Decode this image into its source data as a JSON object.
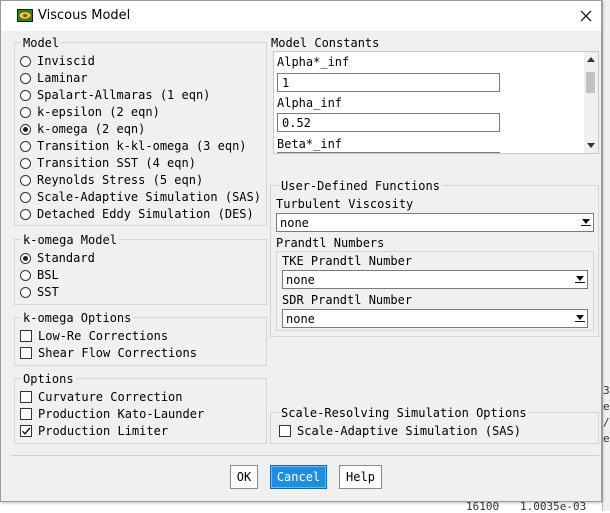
{
  "window": {
    "title": "Viscous Model"
  },
  "model": {
    "title": "Model",
    "options": [
      {
        "label": "Inviscid",
        "selected": false
      },
      {
        "label": "Laminar",
        "selected": false
      },
      {
        "label": "Spalart-Allmaras (1 eqn)",
        "selected": false
      },
      {
        "label": "k-epsilon (2 eqn)",
        "selected": false
      },
      {
        "label": "k-omega (2 eqn)",
        "selected": true
      },
      {
        "label": "Transition k-kl-omega (3 eqn)",
        "selected": false
      },
      {
        "label": "Transition SST (4 eqn)",
        "selected": false
      },
      {
        "label": "Reynolds Stress (5 eqn)",
        "selected": false
      },
      {
        "label": "Scale-Adaptive Simulation (SAS)",
        "selected": false
      },
      {
        "label": "Detached Eddy Simulation (DES)",
        "selected": false
      }
    ]
  },
  "komega_model": {
    "title": "k-omega Model",
    "options": [
      {
        "label": "Standard",
        "selected": true
      },
      {
        "label": "BSL",
        "selected": false
      },
      {
        "label": "SST",
        "selected": false
      }
    ]
  },
  "komega_options": {
    "title": "k-omega Options",
    "items": [
      {
        "label": "Low-Re Corrections",
        "checked": false
      },
      {
        "label": "Shear Flow Corrections",
        "checked": false
      }
    ]
  },
  "options": {
    "title": "Options",
    "items": [
      {
        "label": "Curvature Correction",
        "checked": false
      },
      {
        "label": "Production Kato-Launder",
        "checked": false
      },
      {
        "label": "Production Limiter",
        "checked": true
      }
    ]
  },
  "constants": {
    "title": "Model Constants",
    "items": [
      {
        "label": "Alpha*_inf",
        "value": "1"
      },
      {
        "label": "Alpha_inf",
        "value": "0.52"
      },
      {
        "label": "Beta*_inf",
        "value": ""
      }
    ]
  },
  "udf": {
    "title": "User-Defined Functions",
    "turbulent_viscosity_label": "Turbulent Viscosity",
    "turbulent_viscosity_value": "none",
    "prandtl_title": "Prandtl Numbers",
    "tke_label": "TKE Prandtl Number",
    "tke_value": "none",
    "sdr_label": "SDR Prandtl Number",
    "sdr_value": "none"
  },
  "scale_resolving": {
    "title": "Scale-Resolving Simulation Options",
    "item": {
      "label": "Scale-Adaptive Simulation (SAS)",
      "checked": false
    }
  },
  "buttons": {
    "ok": "OK",
    "cancel": "Cancel",
    "help": "Help"
  },
  "background": {
    "line1": "16100",
    "line2": "1.0035e-03",
    "char1": "3",
    "char2": "e",
    "char3": "/",
    "char4": "e"
  },
  "colors": {
    "accent": "#1e8fe0"
  }
}
